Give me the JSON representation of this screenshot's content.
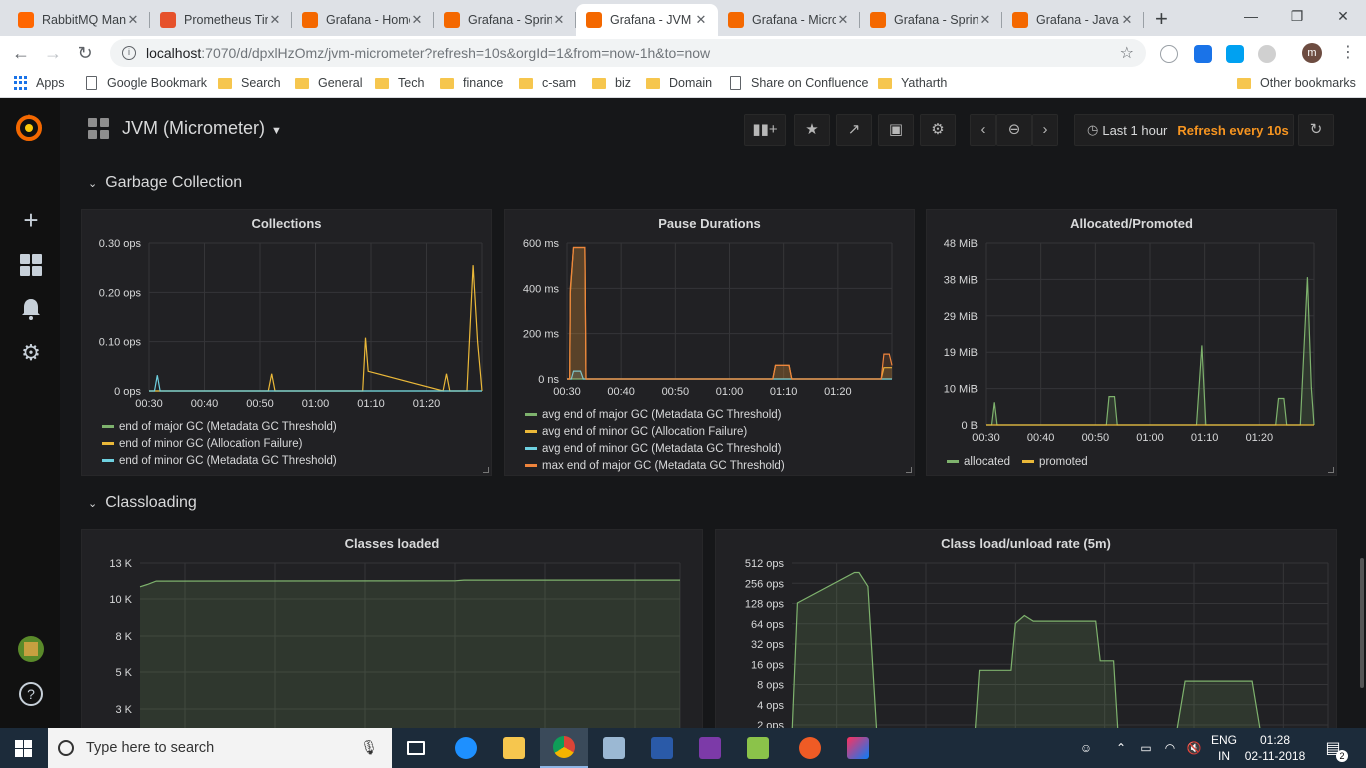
{
  "browser": {
    "tabs": [
      {
        "title": "RabbitMQ Management",
        "fav": "#ff6600"
      },
      {
        "title": "Prometheus Time Series",
        "fav": "#e6522c"
      },
      {
        "title": "Grafana - Home",
        "fav": "#f46800"
      },
      {
        "title": "Grafana - Spring Boot",
        "fav": "#f46800"
      },
      {
        "title": "Grafana - JVM",
        "fav": "#f46800",
        "active": true
      },
      {
        "title": "Grafana - Micrometer",
        "fav": "#f46800"
      },
      {
        "title": "Grafana - Spring",
        "fav": "#f46800"
      },
      {
        "title": "Grafana - Java",
        "fav": "#f46800"
      }
    ],
    "new_tab": "+",
    "url_host": "localhost",
    "url_path": ":7070/d/dpxlHzOmz/jvm-micrometer?refresh=10s&orgId=1&from=now-1h&to=now",
    "profile_initial": "m"
  },
  "bookmarks": [
    {
      "label": "Apps",
      "kind": "apps"
    },
    {
      "label": "Google Bookmark",
      "kind": "page"
    },
    {
      "label": "Search",
      "kind": "folder"
    },
    {
      "label": "General",
      "kind": "folder"
    },
    {
      "label": "Tech",
      "kind": "folder"
    },
    {
      "label": "finance",
      "kind": "folder"
    },
    {
      "label": "c-sam",
      "kind": "folder"
    },
    {
      "label": "biz",
      "kind": "folder"
    },
    {
      "label": "Domain",
      "kind": "folder"
    },
    {
      "label": "Share on Confluence",
      "kind": "page"
    },
    {
      "label": "Yatharth",
      "kind": "folder"
    }
  ],
  "other_bookmarks": "Other bookmarks",
  "grafana": {
    "dashboard_title": "JVM (Micrometer)",
    "time_range": "Last 1 hour",
    "refresh_label": "Refresh every 10s",
    "rows": {
      "gc": "Garbage Collection",
      "classloading": "Classloading"
    },
    "colors": {
      "green": "#7eb26d",
      "yellow": "#eab839",
      "cyan": "#6ed0e0",
      "orange": "#ef843c",
      "red": "#e24d42"
    }
  },
  "chart_data": [
    {
      "title": "Collections",
      "type": "line",
      "x_ticks": [
        "00:30",
        "00:40",
        "00:50",
        "01:00",
        "01:10",
        "01:20"
      ],
      "y_ticks": [
        "0.30 ops",
        "0.20 ops",
        "0.10 ops",
        "0 ops"
      ],
      "ylim": [
        0,
        0.3
      ],
      "xlim": [
        0,
        60
      ],
      "series": [
        {
          "name": "end of major GC (Metadata GC Threshold)",
          "color": "#7eb26d",
          "x": [
            0,
            60
          ],
          "y": [
            0,
            0
          ]
        },
        {
          "name": "end of minor GC (Allocation Failure)",
          "color": "#eab839",
          "x": [
            0,
            21.5,
            22.1,
            22.7,
            38.5,
            39.0,
            39.5,
            53,
            53.6,
            54.2,
            57.3,
            58.4,
            59.2,
            60
          ],
          "y": [
            0,
            0,
            0.035,
            0,
            0,
            0.108,
            0.04,
            0,
            0.035,
            0,
            0,
            0.255,
            0.1,
            0
          ]
        },
        {
          "name": "end of minor GC (Metadata GC Threshold)",
          "color": "#6ed0e0",
          "x": [
            0,
            1,
            1.5,
            2,
            60
          ],
          "y": [
            0,
            0,
            0.032,
            0,
            0
          ]
        }
      ]
    },
    {
      "title": "Pause Durations",
      "type": "line",
      "x_ticks": [
        "00:30",
        "00:40",
        "00:50",
        "01:00",
        "01:10",
        "01:20"
      ],
      "y_ticks": [
        "600 ms",
        "400 ms",
        "200 ms",
        "0 ns"
      ],
      "ylim": [
        0,
        600
      ],
      "xlim": [
        0,
        60
      ],
      "series": [
        {
          "name": "avg end of major GC (Metadata GC Threshold)",
          "color": "#7eb26d",
          "x": [
            0,
            60
          ],
          "y": [
            0,
            0
          ]
        },
        {
          "name": "avg end of minor GC (Allocation Failure)",
          "color": "#eab839",
          "x": [
            0,
            0.5,
            0.6,
            1.2,
            3.3,
            3.5,
            38,
            38.5,
            41,
            41.5,
            58,
            58.5,
            60
          ],
          "y": [
            0,
            0,
            380,
            580,
            580,
            0,
            0,
            60,
            60,
            0,
            0,
            50,
            50
          ]
        },
        {
          "name": "avg end of minor GC (Metadata GC Threshold)",
          "color": "#6ed0e0",
          "x": [
            0,
            0.8,
            1.2,
            2.5,
            3.0,
            60
          ],
          "y": [
            0,
            0,
            35,
            35,
            0,
            0
          ]
        },
        {
          "name": "max end of major GC (Metadata GC Threshold)",
          "color": "#ef843c",
          "x": [
            0,
            0.5,
            0.6,
            1.2,
            3.3,
            3.5,
            38,
            38.5,
            41,
            41.5,
            58,
            58.5,
            59.5,
            60
          ],
          "y": [
            0,
            0,
            400,
            580,
            580,
            0,
            0,
            60,
            60,
            0,
            0,
            110,
            110,
            60
          ]
        }
      ]
    },
    {
      "title": "Allocated/Promoted",
      "type": "line",
      "x_ticks": [
        "00:30",
        "00:40",
        "00:50",
        "01:00",
        "01:10",
        "01:20"
      ],
      "y_ticks": [
        "48 MiB",
        "38 MiB",
        "29 MiB",
        "19 MiB",
        "10 MiB",
        "0 B"
      ],
      "ylim": [
        0,
        48
      ],
      "xlim": [
        0,
        60
      ],
      "series": [
        {
          "name": "allocated",
          "color": "#7eb26d",
          "x": [
            0,
            1,
            1.5,
            2,
            22,
            22.5,
            23.5,
            24,
            38.5,
            39.5,
            40.2,
            53,
            53.5,
            54.5,
            55,
            57.5,
            58.8,
            59.5,
            60
          ],
          "y": [
            0,
            0,
            6,
            0,
            0,
            7.5,
            7.5,
            0,
            0,
            21,
            0,
            0,
            7,
            7,
            0,
            0,
            39,
            10,
            0
          ]
        },
        {
          "name": "promoted",
          "color": "#eab839",
          "x": [
            0,
            60
          ],
          "y": [
            0,
            0
          ]
        }
      ]
    },
    {
      "title": "Classes loaded",
      "type": "area",
      "y_ticks": [
        "13 K",
        "10 K",
        "8 K",
        "5 K",
        "3 K"
      ],
      "ylim": [
        0,
        13000
      ],
      "xlim": [
        0,
        60
      ],
      "series": [
        {
          "name": "",
          "color": "#7eb26d",
          "x": [
            0,
            0.8,
            1.8,
            35,
            36,
            60
          ],
          "y": [
            11400,
            11550,
            11780,
            11800,
            11850,
            11850
          ]
        }
      ]
    },
    {
      "title": "Class load/unload rate (5m)",
      "type": "area",
      "y_ticks": [
        "512 ops",
        "256 ops",
        "128 ops",
        "64 ops",
        "32 ops",
        "16 ops",
        "8 ops",
        "4 ops",
        "2 ops"
      ],
      "scale": "log2",
      "ylim": [
        2,
        512
      ],
      "xlim": [
        0,
        60
      ],
      "series": [
        {
          "name": "",
          "color": "#7eb26d",
          "x": [
            0,
            0.6,
            7,
            7.5,
            8.5,
            9.5,
            20.5,
            21,
            24.5,
            25,
            26,
            27,
            34,
            34.5,
            36,
            36.5,
            38.5,
            43,
            44,
            45,
            51.5,
            52.5
          ],
          "y": [
            1,
            130,
            370,
            370,
            230,
            1,
            1,
            13,
            13,
            65,
            85,
            70,
            70,
            18,
            18,
            1,
            1,
            1,
            9,
            9,
            9,
            1
          ]
        }
      ]
    }
  ],
  "taskbar": {
    "search_placeholder": "Type here to search",
    "lang_top": "ENG",
    "lang_bottom": "IN",
    "time": "01:28",
    "date": "02-11-2018",
    "notif_count": "2"
  }
}
